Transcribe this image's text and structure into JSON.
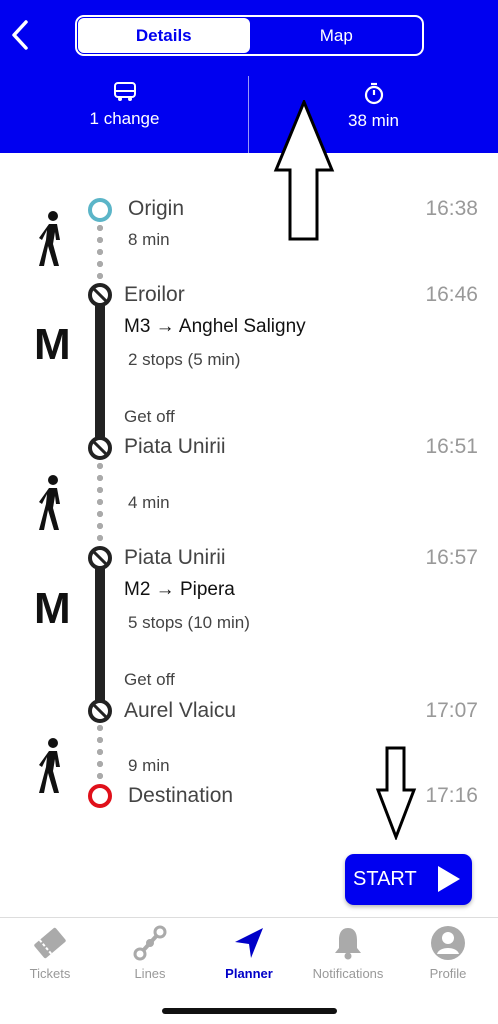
{
  "header": {
    "tabs": [
      {
        "label": "Details",
        "active": true
      },
      {
        "label": "Map",
        "active": false
      }
    ],
    "changes": "1 change",
    "duration": "38 min"
  },
  "itinerary": {
    "origin": {
      "name": "Origin",
      "time": "16:38"
    },
    "walk1": "8 min",
    "leg1": {
      "from": "Eroilor",
      "from_time": "16:46",
      "route": "M3 → Anghel Saligny",
      "stops": "2 stops (5 min)",
      "get_off": "Get off",
      "to": "Piata Unirii",
      "to_time": "16:51",
      "mode": "M"
    },
    "walk2": "4 min",
    "leg2": {
      "from": "Piata Unirii",
      "from_time": "16:57",
      "route": "M2 → Pipera",
      "stops": "5 stops (10 min)",
      "get_off": "Get off",
      "to": "Aurel Vlaicu",
      "to_time": "17:07",
      "mode": "M"
    },
    "walk3": "9 min",
    "destination": {
      "name": "Destination",
      "time": "17:16"
    }
  },
  "start_button": {
    "label": "START"
  },
  "tabbar": {
    "items": [
      {
        "label": "Tickets",
        "icon": "ticket-icon"
      },
      {
        "label": "Lines",
        "icon": "lines-icon"
      },
      {
        "label": "Planner",
        "icon": "navigation-icon",
        "active": true
      },
      {
        "label": "Notifications",
        "icon": "bell-icon"
      },
      {
        "label": "Profile",
        "icon": "user-icon"
      }
    ]
  },
  "colors": {
    "accent": "#0000f0",
    "origin": "#5bb5c8",
    "destination": "#e0101a"
  }
}
